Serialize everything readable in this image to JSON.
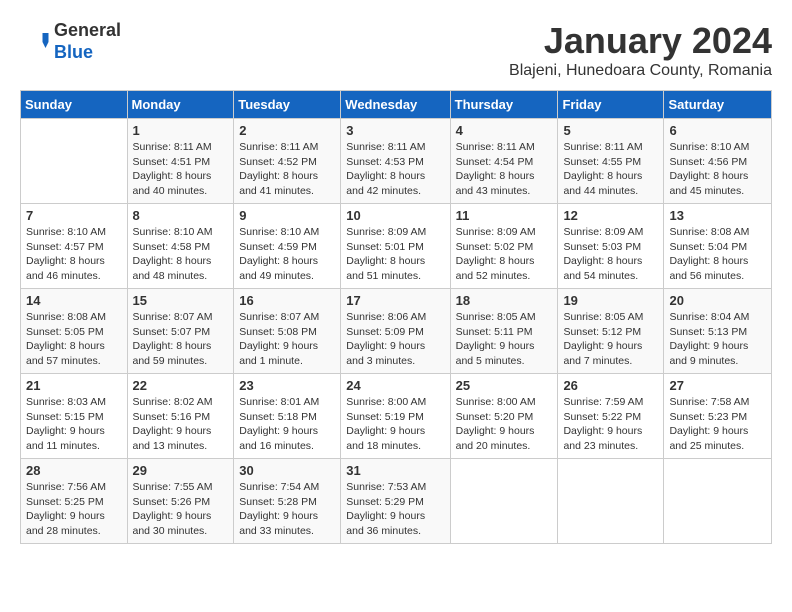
{
  "header": {
    "logo_line1": "General",
    "logo_line2": "Blue",
    "title": "January 2024",
    "subtitle": "Blajeni, Hunedoara County, Romania"
  },
  "days_of_week": [
    "Sunday",
    "Monday",
    "Tuesday",
    "Wednesday",
    "Thursday",
    "Friday",
    "Saturday"
  ],
  "weeks": [
    [
      {
        "day": "",
        "sunrise": "",
        "sunset": "",
        "daylight": ""
      },
      {
        "day": "1",
        "sunrise": "Sunrise: 8:11 AM",
        "sunset": "Sunset: 4:51 PM",
        "daylight": "Daylight: 8 hours and 40 minutes."
      },
      {
        "day": "2",
        "sunrise": "Sunrise: 8:11 AM",
        "sunset": "Sunset: 4:52 PM",
        "daylight": "Daylight: 8 hours and 41 minutes."
      },
      {
        "day": "3",
        "sunrise": "Sunrise: 8:11 AM",
        "sunset": "Sunset: 4:53 PM",
        "daylight": "Daylight: 8 hours and 42 minutes."
      },
      {
        "day": "4",
        "sunrise": "Sunrise: 8:11 AM",
        "sunset": "Sunset: 4:54 PM",
        "daylight": "Daylight: 8 hours and 43 minutes."
      },
      {
        "day": "5",
        "sunrise": "Sunrise: 8:11 AM",
        "sunset": "Sunset: 4:55 PM",
        "daylight": "Daylight: 8 hours and 44 minutes."
      },
      {
        "day": "6",
        "sunrise": "Sunrise: 8:10 AM",
        "sunset": "Sunset: 4:56 PM",
        "daylight": "Daylight: 8 hours and 45 minutes."
      }
    ],
    [
      {
        "day": "7",
        "sunrise": "Sunrise: 8:10 AM",
        "sunset": "Sunset: 4:57 PM",
        "daylight": "Daylight: 8 hours and 46 minutes."
      },
      {
        "day": "8",
        "sunrise": "Sunrise: 8:10 AM",
        "sunset": "Sunset: 4:58 PM",
        "daylight": "Daylight: 8 hours and 48 minutes."
      },
      {
        "day": "9",
        "sunrise": "Sunrise: 8:10 AM",
        "sunset": "Sunset: 4:59 PM",
        "daylight": "Daylight: 8 hours and 49 minutes."
      },
      {
        "day": "10",
        "sunrise": "Sunrise: 8:09 AM",
        "sunset": "Sunset: 5:01 PM",
        "daylight": "Daylight: 8 hours and 51 minutes."
      },
      {
        "day": "11",
        "sunrise": "Sunrise: 8:09 AM",
        "sunset": "Sunset: 5:02 PM",
        "daylight": "Daylight: 8 hours and 52 minutes."
      },
      {
        "day": "12",
        "sunrise": "Sunrise: 8:09 AM",
        "sunset": "Sunset: 5:03 PM",
        "daylight": "Daylight: 8 hours and 54 minutes."
      },
      {
        "day": "13",
        "sunrise": "Sunrise: 8:08 AM",
        "sunset": "Sunset: 5:04 PM",
        "daylight": "Daylight: 8 hours and 56 minutes."
      }
    ],
    [
      {
        "day": "14",
        "sunrise": "Sunrise: 8:08 AM",
        "sunset": "Sunset: 5:05 PM",
        "daylight": "Daylight: 8 hours and 57 minutes."
      },
      {
        "day": "15",
        "sunrise": "Sunrise: 8:07 AM",
        "sunset": "Sunset: 5:07 PM",
        "daylight": "Daylight: 8 hours and 59 minutes."
      },
      {
        "day": "16",
        "sunrise": "Sunrise: 8:07 AM",
        "sunset": "Sunset: 5:08 PM",
        "daylight": "Daylight: 9 hours and 1 minute."
      },
      {
        "day": "17",
        "sunrise": "Sunrise: 8:06 AM",
        "sunset": "Sunset: 5:09 PM",
        "daylight": "Daylight: 9 hours and 3 minutes."
      },
      {
        "day": "18",
        "sunrise": "Sunrise: 8:05 AM",
        "sunset": "Sunset: 5:11 PM",
        "daylight": "Daylight: 9 hours and 5 minutes."
      },
      {
        "day": "19",
        "sunrise": "Sunrise: 8:05 AM",
        "sunset": "Sunset: 5:12 PM",
        "daylight": "Daylight: 9 hours and 7 minutes."
      },
      {
        "day": "20",
        "sunrise": "Sunrise: 8:04 AM",
        "sunset": "Sunset: 5:13 PM",
        "daylight": "Daylight: 9 hours and 9 minutes."
      }
    ],
    [
      {
        "day": "21",
        "sunrise": "Sunrise: 8:03 AM",
        "sunset": "Sunset: 5:15 PM",
        "daylight": "Daylight: 9 hours and 11 minutes."
      },
      {
        "day": "22",
        "sunrise": "Sunrise: 8:02 AM",
        "sunset": "Sunset: 5:16 PM",
        "daylight": "Daylight: 9 hours and 13 minutes."
      },
      {
        "day": "23",
        "sunrise": "Sunrise: 8:01 AM",
        "sunset": "Sunset: 5:18 PM",
        "daylight": "Daylight: 9 hours and 16 minutes."
      },
      {
        "day": "24",
        "sunrise": "Sunrise: 8:00 AM",
        "sunset": "Sunset: 5:19 PM",
        "daylight": "Daylight: 9 hours and 18 minutes."
      },
      {
        "day": "25",
        "sunrise": "Sunrise: 8:00 AM",
        "sunset": "Sunset: 5:20 PM",
        "daylight": "Daylight: 9 hours and 20 minutes."
      },
      {
        "day": "26",
        "sunrise": "Sunrise: 7:59 AM",
        "sunset": "Sunset: 5:22 PM",
        "daylight": "Daylight: 9 hours and 23 minutes."
      },
      {
        "day": "27",
        "sunrise": "Sunrise: 7:58 AM",
        "sunset": "Sunset: 5:23 PM",
        "daylight": "Daylight: 9 hours and 25 minutes."
      }
    ],
    [
      {
        "day": "28",
        "sunrise": "Sunrise: 7:56 AM",
        "sunset": "Sunset: 5:25 PM",
        "daylight": "Daylight: 9 hours and 28 minutes."
      },
      {
        "day": "29",
        "sunrise": "Sunrise: 7:55 AM",
        "sunset": "Sunset: 5:26 PM",
        "daylight": "Daylight: 9 hours and 30 minutes."
      },
      {
        "day": "30",
        "sunrise": "Sunrise: 7:54 AM",
        "sunset": "Sunset: 5:28 PM",
        "daylight": "Daylight: 9 hours and 33 minutes."
      },
      {
        "day": "31",
        "sunrise": "Sunrise: 7:53 AM",
        "sunset": "Sunset: 5:29 PM",
        "daylight": "Daylight: 9 hours and 36 minutes."
      },
      {
        "day": "",
        "sunrise": "",
        "sunset": "",
        "daylight": ""
      },
      {
        "day": "",
        "sunrise": "",
        "sunset": "",
        "daylight": ""
      },
      {
        "day": "",
        "sunrise": "",
        "sunset": "",
        "daylight": ""
      }
    ]
  ]
}
